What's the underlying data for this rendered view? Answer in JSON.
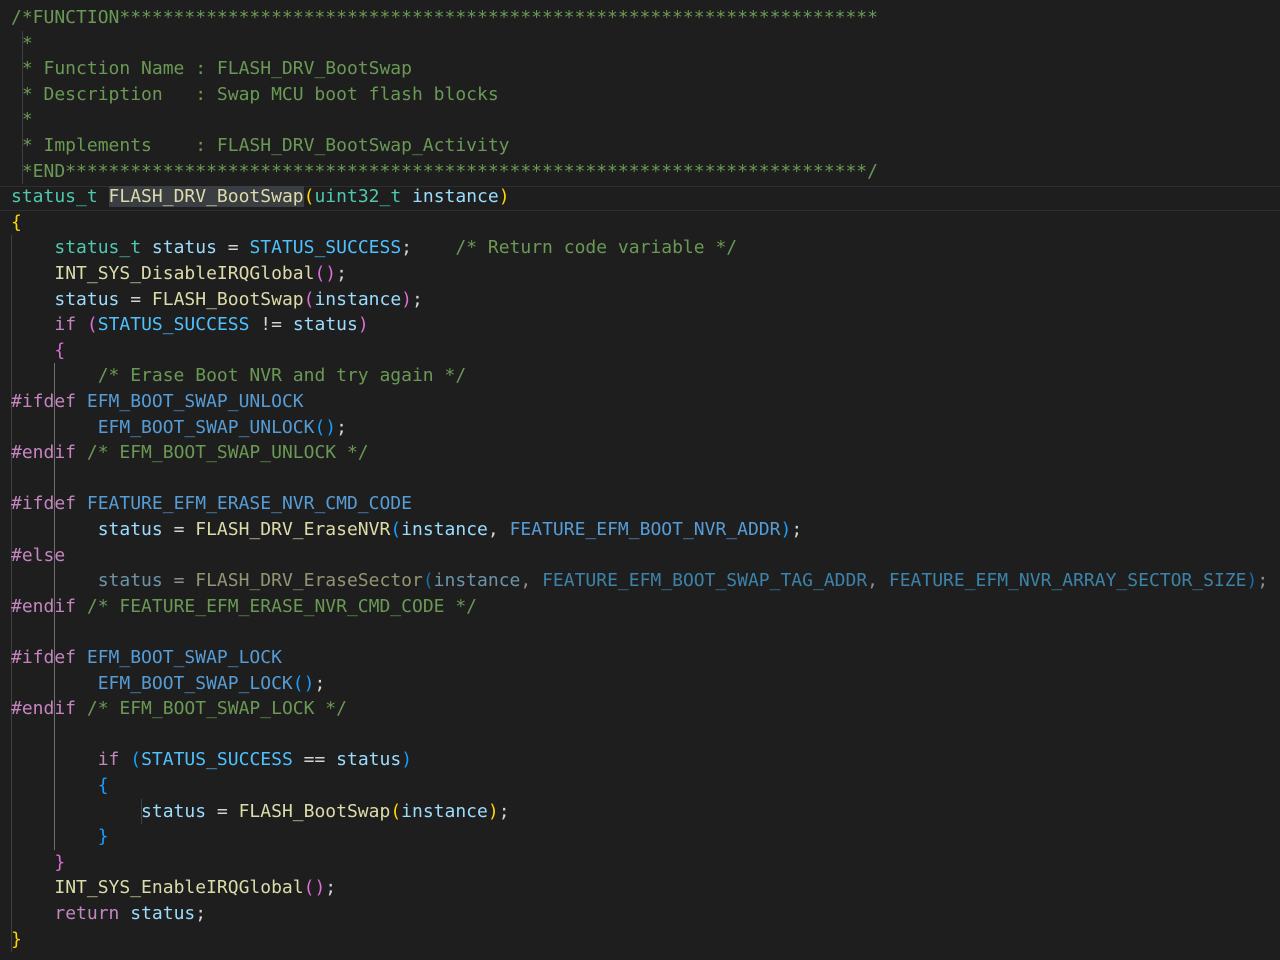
{
  "editor": {
    "language": "c",
    "colors": {
      "background": "#1e1e1e",
      "comment": "#6a9955",
      "type": "#4ec9b0",
      "function": "#dcdcaa",
      "variable": "#9cdcfe",
      "constant": "#4fc1ff",
      "keyword": "#c586c0",
      "bracket_gold": "#ffd700",
      "bracket_orchid": "#da70d6",
      "bracket_blue": "#179fff"
    },
    "lines": [
      [
        {
          "t": "/*FUNCTION**********************************************************************",
          "c": "comment"
        }
      ],
      [
        {
          "t": " *",
          "c": "comment"
        }
      ],
      [
        {
          "t": " * Function Name : FLASH_DRV_BootSwap",
          "c": "comment"
        }
      ],
      [
        {
          "t": " * Description   : Swap MCU boot flash blocks",
          "c": "comment"
        }
      ],
      [
        {
          "t": " *",
          "c": "comment"
        }
      ],
      [
        {
          "t": " * Implements    : FLASH_DRV_BootSwap_Activity",
          "c": "comment"
        }
      ],
      [
        {
          "t": " *END**************************************************************************/",
          "c": "comment"
        }
      ],
      [
        {
          "t": "status_t",
          "c": "type"
        },
        {
          "t": " ",
          "c": "plain"
        },
        {
          "t": "FLASH_DRV_BootSwap",
          "c": "func",
          "hl": true
        },
        {
          "t": "(",
          "c": "b1"
        },
        {
          "t": "uint32_t",
          "c": "type"
        },
        {
          "t": " ",
          "c": "plain"
        },
        {
          "t": "instance",
          "c": "var"
        },
        {
          "t": ")",
          "c": "b1"
        }
      ],
      [
        {
          "t": "{",
          "c": "b1"
        }
      ],
      [
        {
          "t": "    ",
          "c": "plain"
        },
        {
          "t": "status_t",
          "c": "type"
        },
        {
          "t": " ",
          "c": "plain"
        },
        {
          "t": "status",
          "c": "var"
        },
        {
          "t": " = ",
          "c": "plain"
        },
        {
          "t": "STATUS_SUCCESS",
          "c": "const"
        },
        {
          "t": ";    ",
          "c": "plain"
        },
        {
          "t": "/* Return code variable */",
          "c": "comment"
        }
      ],
      [
        {
          "t": "    ",
          "c": "plain"
        },
        {
          "t": "INT_SYS_DisableIRQGlobal",
          "c": "func"
        },
        {
          "t": "()",
          "c": "b2"
        },
        {
          "t": ";",
          "c": "plain"
        }
      ],
      [
        {
          "t": "    ",
          "c": "plain"
        },
        {
          "t": "status",
          "c": "var"
        },
        {
          "t": " = ",
          "c": "plain"
        },
        {
          "t": "FLASH_BootSwap",
          "c": "func"
        },
        {
          "t": "(",
          "c": "b2"
        },
        {
          "t": "instance",
          "c": "var"
        },
        {
          "t": ")",
          "c": "b2"
        },
        {
          "t": ";",
          "c": "plain"
        }
      ],
      [
        {
          "t": "    ",
          "c": "plain"
        },
        {
          "t": "if",
          "c": "kw"
        },
        {
          "t": " ",
          "c": "plain"
        },
        {
          "t": "(",
          "c": "b2"
        },
        {
          "t": "STATUS_SUCCESS",
          "c": "const"
        },
        {
          "t": " != ",
          "c": "plain"
        },
        {
          "t": "status",
          "c": "var"
        },
        {
          "t": ")",
          "c": "b2"
        }
      ],
      [
        {
          "t": "    ",
          "c": "plain"
        },
        {
          "t": "{",
          "c": "b2"
        }
      ],
      [
        {
          "t": "        ",
          "c": "plain"
        },
        {
          "t": "/* Erase Boot NVR and try again */",
          "c": "comment"
        }
      ],
      [
        {
          "t": "#ifdef",
          "c": "pre"
        },
        {
          "t": " ",
          "c": "plain"
        },
        {
          "t": "EFM_BOOT_SWAP_UNLOCK",
          "c": "macro"
        }
      ],
      [
        {
          "t": "        ",
          "c": "plain"
        },
        {
          "t": "EFM_BOOT_SWAP_UNLOCK",
          "c": "macro"
        },
        {
          "t": "()",
          "c": "b3"
        },
        {
          "t": ";",
          "c": "plain"
        }
      ],
      [
        {
          "t": "#endif",
          "c": "pre"
        },
        {
          "t": " ",
          "c": "plain"
        },
        {
          "t": "/* EFM_BOOT_SWAP_UNLOCK */",
          "c": "comment"
        }
      ],
      [],
      [
        {
          "t": "#ifdef",
          "c": "pre"
        },
        {
          "t": " ",
          "c": "plain"
        },
        {
          "t": "FEATURE_EFM_ERASE_NVR_CMD_CODE",
          "c": "macro"
        }
      ],
      [
        {
          "t": "        ",
          "c": "plain"
        },
        {
          "t": "status",
          "c": "var"
        },
        {
          "t": " = ",
          "c": "plain"
        },
        {
          "t": "FLASH_DRV_EraseNVR",
          "c": "func"
        },
        {
          "t": "(",
          "c": "b3"
        },
        {
          "t": "instance",
          "c": "var"
        },
        {
          "t": ", ",
          "c": "plain"
        },
        {
          "t": "FEATURE_EFM_BOOT_NVR_ADDR",
          "c": "macro"
        },
        {
          "t": ")",
          "c": "b3"
        },
        {
          "t": ";",
          "c": "plain"
        }
      ],
      [
        {
          "t": "#else",
          "c": "pre"
        }
      ],
      [
        {
          "t": "        ",
          "c": "plain"
        },
        {
          "t": "status",
          "c": "var",
          "dim": true
        },
        {
          "t": " = ",
          "c": "plain",
          "dim": true
        },
        {
          "t": "FLASH_DRV_EraseSector",
          "c": "func",
          "dim": true
        },
        {
          "t": "(",
          "c": "b3",
          "dim": true
        },
        {
          "t": "instance",
          "c": "var",
          "dim": true
        },
        {
          "t": ", ",
          "c": "plain",
          "dim": true
        },
        {
          "t": "FEATURE_EFM_BOOT_SWAP_TAG_ADDR",
          "c": "const",
          "dim": true
        },
        {
          "t": ", ",
          "c": "plain",
          "dim": true
        },
        {
          "t": "FEATURE_EFM_NVR_ARRAY_SECTOR_SIZE",
          "c": "const",
          "dim": true
        },
        {
          "t": ")",
          "c": "b3",
          "dim": true
        },
        {
          "t": ";",
          "c": "plain",
          "dim": true
        }
      ],
      [
        {
          "t": "#endif",
          "c": "pre"
        },
        {
          "t": " ",
          "c": "plain"
        },
        {
          "t": "/* FEATURE_EFM_ERASE_NVR_CMD_CODE */",
          "c": "comment"
        }
      ],
      [],
      [
        {
          "t": "#ifdef",
          "c": "pre"
        },
        {
          "t": " ",
          "c": "plain"
        },
        {
          "t": "EFM_BOOT_SWAP_LOCK",
          "c": "macro"
        }
      ],
      [
        {
          "t": "        ",
          "c": "plain"
        },
        {
          "t": "EFM_BOOT_SWAP_LOCK",
          "c": "macro"
        },
        {
          "t": "()",
          "c": "b3"
        },
        {
          "t": ";",
          "c": "plain"
        }
      ],
      [
        {
          "t": "#endif",
          "c": "pre"
        },
        {
          "t": " ",
          "c": "plain"
        },
        {
          "t": "/* EFM_BOOT_SWAP_LOCK */",
          "c": "comment"
        }
      ],
      [],
      [
        {
          "t": "        ",
          "c": "plain"
        },
        {
          "t": "if",
          "c": "kw"
        },
        {
          "t": " ",
          "c": "plain"
        },
        {
          "t": "(",
          "c": "b3"
        },
        {
          "t": "STATUS_SUCCESS",
          "c": "const"
        },
        {
          "t": " == ",
          "c": "plain"
        },
        {
          "t": "status",
          "c": "var"
        },
        {
          "t": ")",
          "c": "b3"
        }
      ],
      [
        {
          "t": "        ",
          "c": "plain"
        },
        {
          "t": "{",
          "c": "b3"
        }
      ],
      [
        {
          "t": "            ",
          "c": "plain"
        },
        {
          "t": "status",
          "c": "var"
        },
        {
          "t": " = ",
          "c": "plain"
        },
        {
          "t": "FLASH_BootSwap",
          "c": "func"
        },
        {
          "t": "(",
          "c": "b1"
        },
        {
          "t": "instance",
          "c": "var"
        },
        {
          "t": ")",
          "c": "b1"
        },
        {
          "t": ";",
          "c": "plain"
        }
      ],
      [
        {
          "t": "        ",
          "c": "plain"
        },
        {
          "t": "}",
          "c": "b3"
        }
      ],
      [
        {
          "t": "    ",
          "c": "plain"
        },
        {
          "t": "}",
          "c": "b2"
        }
      ],
      [
        {
          "t": "    ",
          "c": "plain"
        },
        {
          "t": "INT_SYS_EnableIRQGlobal",
          "c": "func"
        },
        {
          "t": "()",
          "c": "b2"
        },
        {
          "t": ";",
          "c": "plain"
        }
      ],
      [
        {
          "t": "    ",
          "c": "plain"
        },
        {
          "t": "return",
          "c": "kw"
        },
        {
          "t": " ",
          "c": "plain"
        },
        {
          "t": "status",
          "c": "var"
        },
        {
          "t": ";",
          "c": "plain"
        }
      ],
      [
        {
          "t": "}",
          "c": "b1"
        }
      ]
    ]
  }
}
